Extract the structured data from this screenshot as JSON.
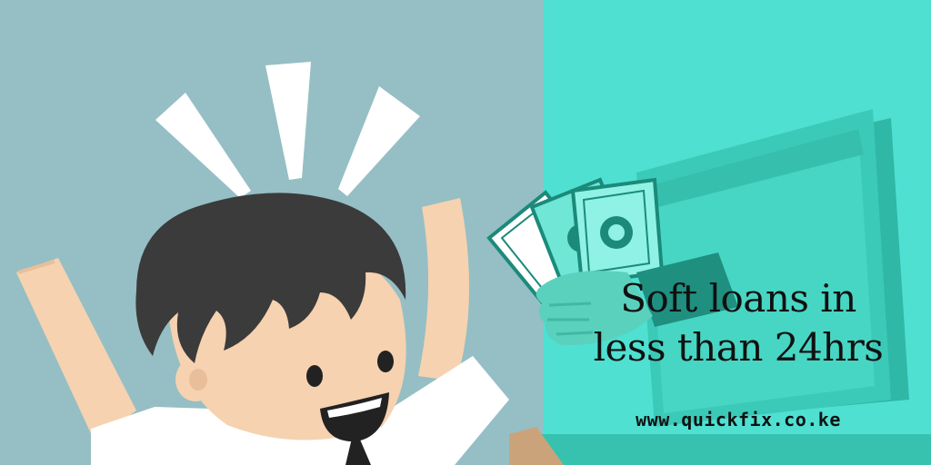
{
  "banner": {
    "headline_line1": "Soft loans in",
    "headline_line2": "less than 24hrs",
    "website": "www.quickfix.co.ke"
  },
  "colors": {
    "left_background": "#95bfc4",
    "right_background": "#4fe0d2",
    "text": "#111111",
    "hair": "#3b3b3b",
    "skin": "#f6d2b0",
    "money": "#1c8a7a",
    "monitor": "#2fb8a6"
  },
  "illustration": {
    "left": "excited cartoon man with raised arms",
    "right": "hand holding cash coming out of a computer monitor"
  }
}
